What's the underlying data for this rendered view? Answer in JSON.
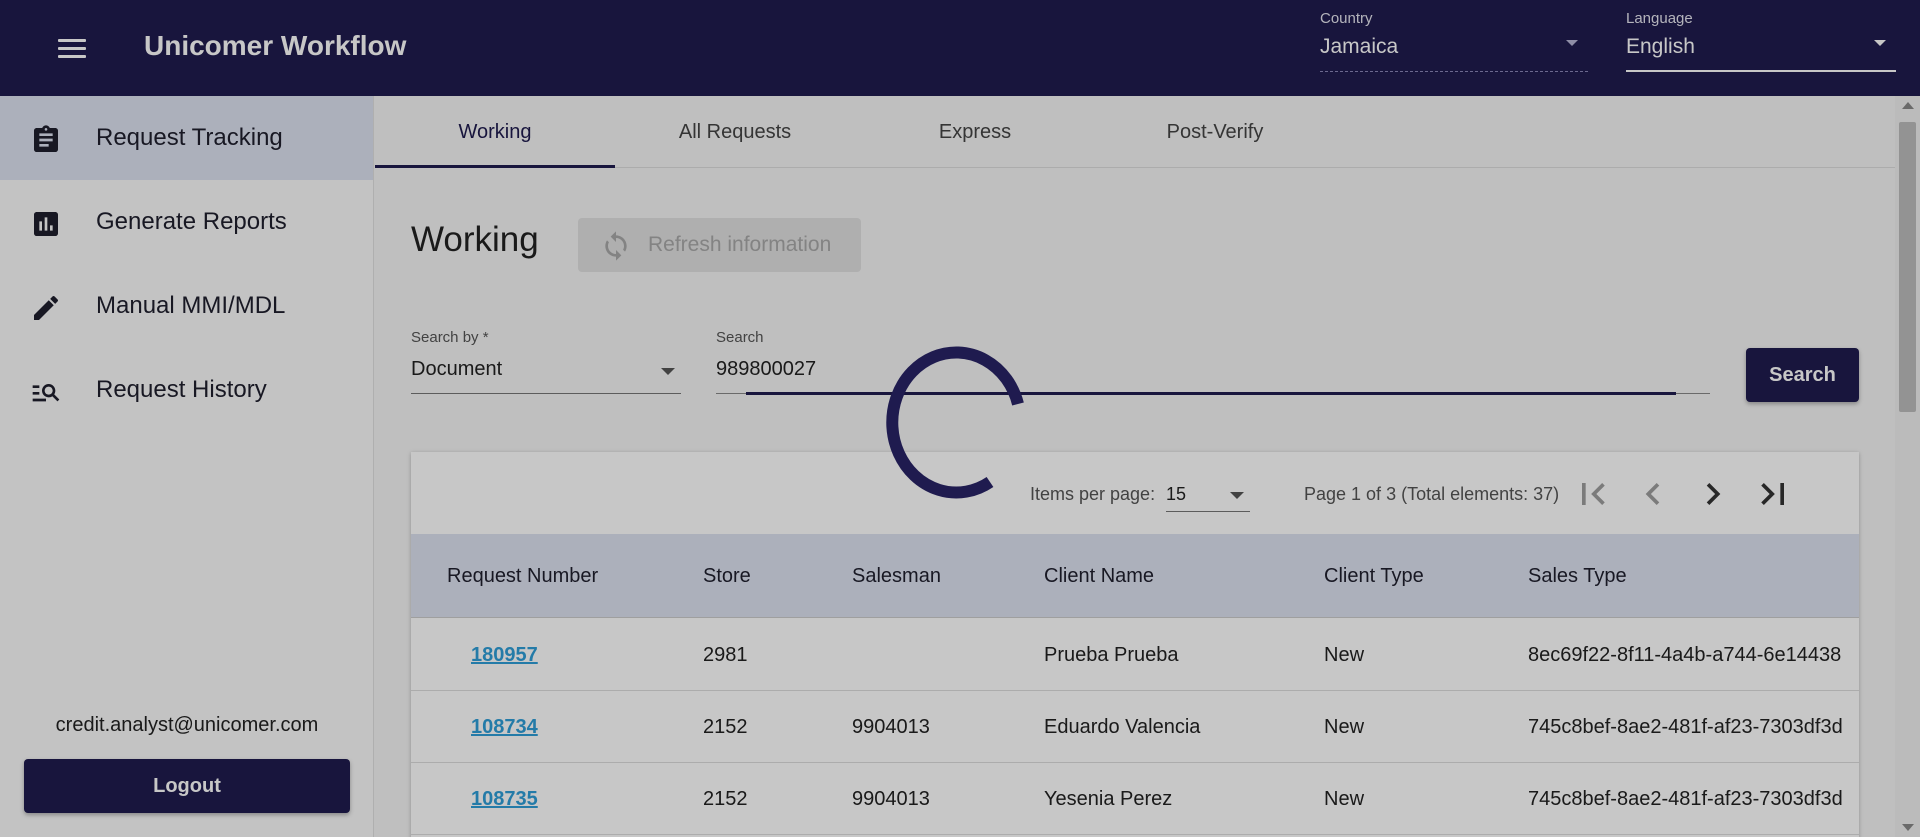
{
  "header": {
    "title": "Unicomer Workflow",
    "country_label": "Country",
    "country_value": "Jamaica",
    "language_label": "Language",
    "language_value": "English"
  },
  "sidebar": {
    "items": [
      {
        "label": "Request Tracking",
        "icon": "clipboard-icon",
        "active": true
      },
      {
        "label": "Generate Reports",
        "icon": "report-chart-icon",
        "active": false
      },
      {
        "label": "Manual MMI/MDL",
        "icon": "pencil-icon",
        "active": false
      },
      {
        "label": "Request History",
        "icon": "manage-search-icon",
        "active": false
      }
    ],
    "user_email": "credit.analyst@unicomer.com",
    "logout_label": "Logout"
  },
  "tabs": [
    {
      "label": "Working",
      "active": true
    },
    {
      "label": "All Requests",
      "active": false
    },
    {
      "label": "Express",
      "active": false
    },
    {
      "label": "Post-Verify",
      "active": false
    }
  ],
  "main": {
    "page_title": "Working",
    "refresh_label": "Refresh information",
    "search_by_label": "Search by *",
    "search_by_value": "Document",
    "search_label": "Search",
    "search_value": "989800027",
    "search_button": "Search"
  },
  "paginator": {
    "items_per_page_label": "Items per page:",
    "items_per_page_value": "15",
    "range_label": "Page 1 of 3 (Total elements: 37)"
  },
  "table": {
    "columns": [
      "Request Number",
      "Store",
      "Salesman",
      "Client Name",
      "Client Type",
      "Sales Type"
    ],
    "rows": [
      {
        "request_number": "180957",
        "store": "2981",
        "salesman": "",
        "client_name": "Prueba Prueba",
        "client_type": "New",
        "sales_type": "8ec69f22-8f11-4a4b-a744-6e14438"
      },
      {
        "request_number": "108734",
        "store": "2152",
        "salesman": "9904013",
        "client_name": "Eduardo Valencia",
        "client_type": "New",
        "sales_type": "745c8bef-8ae2-481f-af23-7303df3d"
      },
      {
        "request_number": "108735",
        "store": "2152",
        "salesman": "9904013",
        "client_name": "Yesenia Perez",
        "client_type": "New",
        "sales_type": "745c8bef-8ae2-481f-af23-7303df3d"
      }
    ]
  },
  "colors": {
    "primary": "#1f1b4f",
    "link": "#2f9ed8",
    "header_row": "#dde2f0"
  }
}
